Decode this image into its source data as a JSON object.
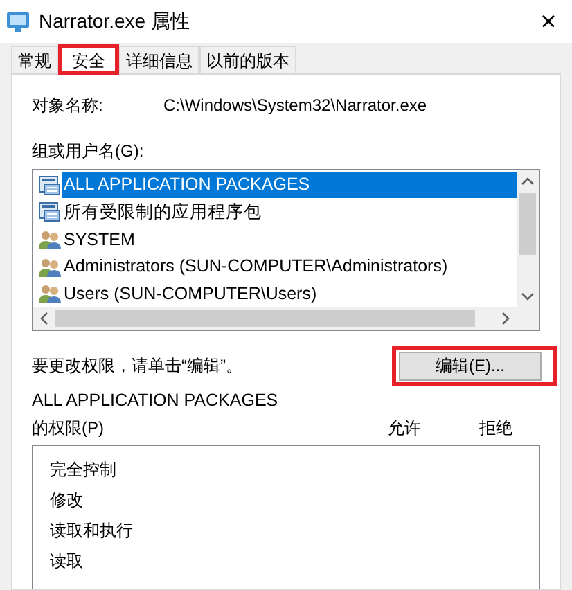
{
  "window": {
    "title": "Narrator.exe 属性",
    "close": "×"
  },
  "tabs": [
    {
      "label": "常规",
      "selected": false,
      "highlighted": false
    },
    {
      "label": "安全",
      "selected": true,
      "highlighted": true
    },
    {
      "label": "详细信息",
      "selected": false,
      "highlighted": false
    },
    {
      "label": "以前的版本",
      "selected": false,
      "highlighted": false
    }
  ],
  "object_name": {
    "label": "对象名称:",
    "value": "C:\\Windows\\System32\\Narrator.exe"
  },
  "groups": {
    "label": "组或用户名(G):",
    "items": [
      {
        "name": "ALL APPLICATION PACKAGES",
        "kind": "package",
        "selected": true
      },
      {
        "name": "所有受限制的应用程序包",
        "kind": "package",
        "selected": false
      },
      {
        "name": "SYSTEM",
        "kind": "user",
        "selected": false
      },
      {
        "name": "Administrators (SUN-COMPUTER\\Administrators)",
        "kind": "user",
        "selected": false
      },
      {
        "name": "Users (SUN-COMPUTER\\Users)",
        "kind": "user",
        "selected": false
      }
    ]
  },
  "edit_note": "要更改权限，请单击“编辑”。",
  "edit_button": {
    "label": "编辑(E)...",
    "highlighted": true
  },
  "permissions": {
    "subject": "ALL APPLICATION PACKAGES",
    "label": "的权限(P)",
    "columns": [
      "允许",
      "拒绝"
    ],
    "rows": [
      "完全控制",
      "修改",
      "读取和执行",
      "读取"
    ]
  }
}
